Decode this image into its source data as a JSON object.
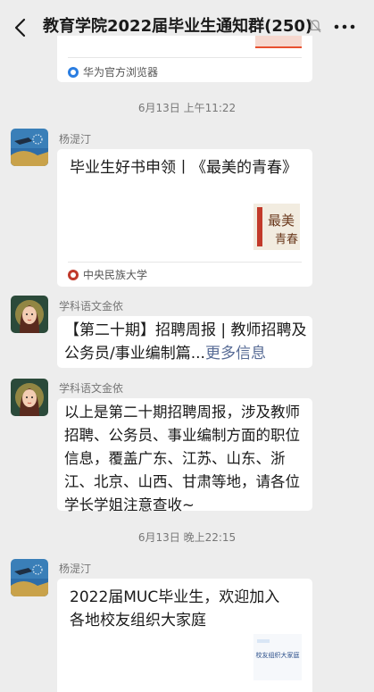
{
  "header": {
    "title": "教育学院2022届毕业生通知群(250)",
    "back_icon": "chevron-left-icon",
    "mute_icon": "bell-off-icon",
    "more_icon": "more-icon"
  },
  "top_card": {
    "source": "华为官方浏览器"
  },
  "timestamps": {
    "t1": "6月13日 上午11:22",
    "t2": "6月13日 晚上22:15"
  },
  "messages": [
    {
      "sender": "杨湜汀",
      "text": "毕业生好书申领丨《最美的青春》",
      "source": "中央民族大学"
    },
    {
      "sender": "学科语文金依",
      "text_main": "【第二十期】招聘周报 | 教师招聘及公务员/事业编制篇...",
      "text_link": "更多信息"
    },
    {
      "sender": "学科语文金依",
      "text": "以上是第二十期招聘周报，涉及教师招聘、公务员、事业编制方面的职位信息，覆盖广东、江苏、山东、浙江、北京、山西、甘肃等地，请各位学长学姐注意查收~"
    },
    {
      "sender": "杨湜汀",
      "text": "2022届MUC毕业生，欢迎加入各地校友组织大家庭",
      "thumb_caption": "校友组织大家庭"
    }
  ],
  "colors": {
    "background": "#ededed",
    "bubble": "#ffffff",
    "link": "#576b95",
    "accent_red": "#e8502f"
  }
}
